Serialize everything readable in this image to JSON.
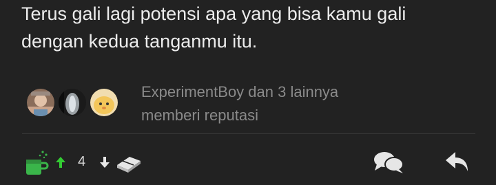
{
  "post": {
    "body_line1": "Terus gali lagi potensi apa yang bisa kamu gali",
    "body_line2": "dengan kedua tanganmu itu."
  },
  "reputation": {
    "line1": "ExperimentBoy dan 3 lainnya",
    "line2": "memberi reputasi",
    "avatars": [
      "user-avatar-1",
      "user-avatar-2",
      "user-avatar-3"
    ]
  },
  "actions": {
    "vote_count": "4",
    "icons": {
      "cendol": "cendol-cup-icon",
      "upvote": "arrow-up-icon",
      "downvote": "arrow-down-icon",
      "bata": "brick-icon",
      "comment": "comment-bubbles-icon",
      "reply": "reply-arrow-icon"
    }
  },
  "colors": {
    "background": "#222222",
    "text_primary": "#ececec",
    "text_muted": "#8a8a8a",
    "cendol_green": "#3ab54a",
    "upvote_green": "#33cc33",
    "icon_light": "#e6e6e6"
  }
}
